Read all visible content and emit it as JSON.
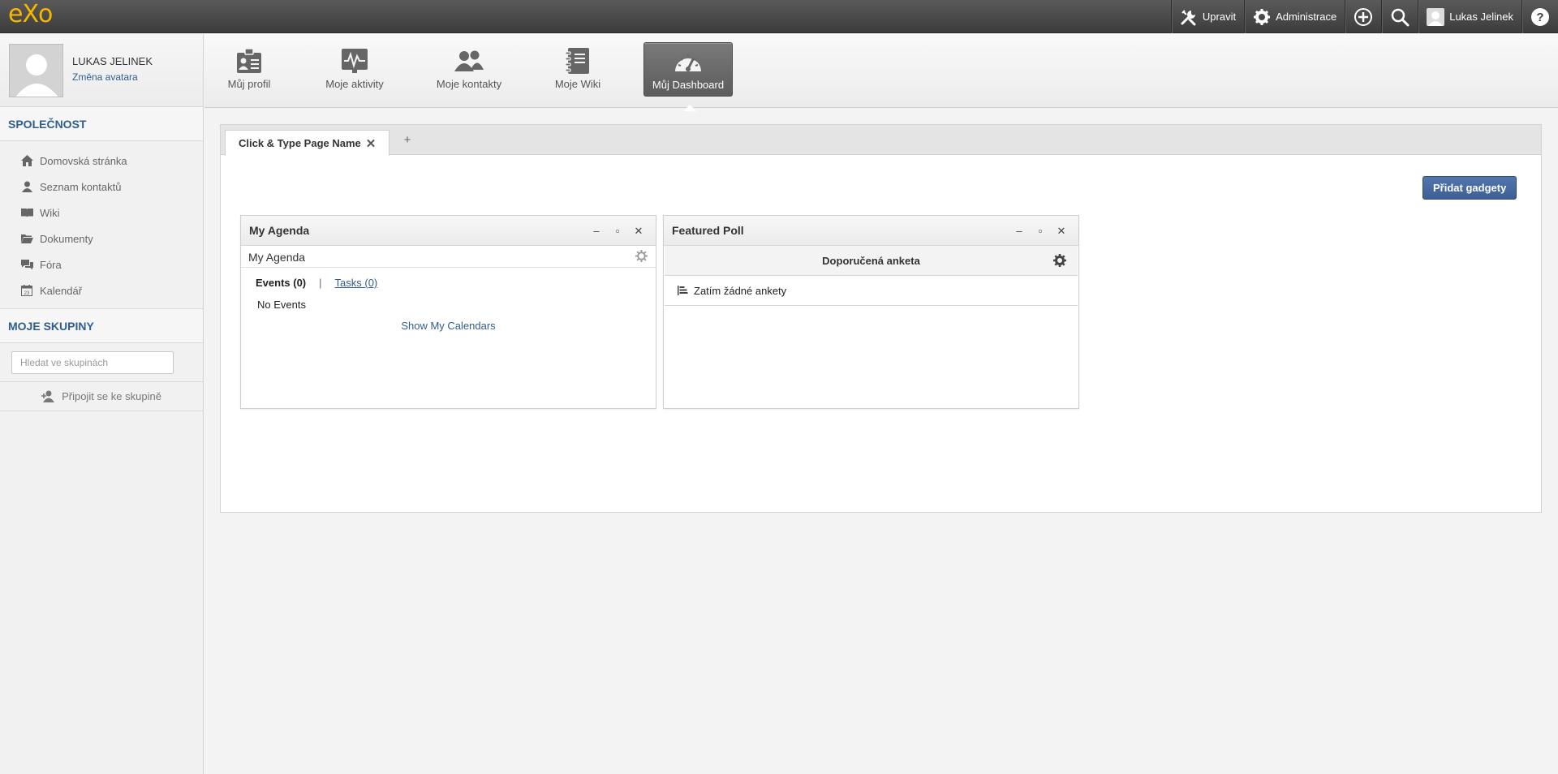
{
  "topbar": {
    "logo": "eXo",
    "edit_label": "Upravit",
    "admin_label": "Administrace",
    "user_name": "Lukas Jelinek"
  },
  "sidebar": {
    "user_name": "LUKAS JELINEK",
    "change_avatar": "Změna avatara",
    "company_title": "SPOLEČNOST",
    "items": [
      {
        "label": "Domovská stránka",
        "icon": "home-icon"
      },
      {
        "label": "Seznam kontaktů",
        "icon": "user-icon"
      },
      {
        "label": "Wiki",
        "icon": "book-icon"
      },
      {
        "label": "Dokumenty",
        "icon": "folder-icon"
      },
      {
        "label": "Fóra",
        "icon": "chat-icon"
      },
      {
        "label": "Kalendář",
        "icon": "calendar-icon"
      }
    ],
    "groups_title": "MOJE SKUPINY",
    "groups_search_placeholder": "Hledat ve skupinách",
    "join_group": "Připojit se ke skupině"
  },
  "apps": [
    {
      "label": "Můj profil",
      "icon": "profile-icon"
    },
    {
      "label": "Moje aktivity",
      "icon": "activity-icon"
    },
    {
      "label": "Moje kontakty",
      "icon": "contacts-icon"
    },
    {
      "label": "Moje Wiki",
      "icon": "wiki-icon"
    },
    {
      "label": "Můj Dashboard",
      "icon": "dashboard-icon",
      "active": true
    }
  ],
  "dashboard": {
    "tab_name": "Click & Type Page Name",
    "tab_close": "✕",
    "tab_add": "+",
    "add_gadgets": "Přidat gadgety",
    "agenda": {
      "title": "My Agenda",
      "subtitle": "My Agenda",
      "events_tab": "Events (0)",
      "separator": "|",
      "tasks_tab": "Tasks (0)",
      "no_events": "No Events",
      "show_calendars": "Show My Calendars"
    },
    "poll": {
      "title": "Featured Poll",
      "header": "Doporučená anketa",
      "empty": "Zatím žádné ankety"
    }
  },
  "colors": {
    "accent_blue": "#2f5e8e",
    "logo_yellow": "#f5b800",
    "button_blue": "#4669a0"
  }
}
